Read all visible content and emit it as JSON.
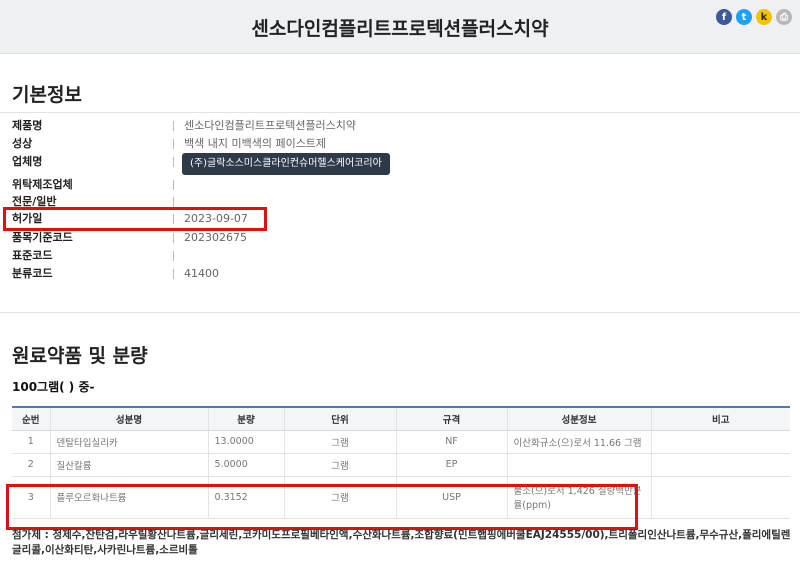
{
  "header": {
    "title": "센소다인컴플리트프로텍션플러스치약",
    "share": [
      {
        "name": "facebook-icon",
        "glyph": "f"
      },
      {
        "name": "twitter-icon",
        "glyph": "t"
      },
      {
        "name": "kakaostory-icon",
        "glyph": "k"
      },
      {
        "name": "print-icon",
        "glyph": "⎙"
      }
    ]
  },
  "basic_info": {
    "title": "기본정보",
    "rows": [
      {
        "label": "제품명",
        "value": "센소다인컴플리트프로텍션플러스치약"
      },
      {
        "label": "성상",
        "value": "백색 내지 미백색의 페이스트제"
      },
      {
        "label": "업체명",
        "value": "(주)글락소스미스클라인컨슈머헬스케어코리아"
      },
      {
        "label": "위탁제조업체",
        "value": ""
      },
      {
        "label": "전문/일반",
        "value": ""
      },
      {
        "label": "허가일",
        "value": "2023-09-07"
      },
      {
        "label": "품목기준코드",
        "value": "202302675"
      },
      {
        "label": "표준코드",
        "value": ""
      },
      {
        "label": "분류코드",
        "value": "41400"
      }
    ]
  },
  "ingredients": {
    "title": "원료약품 및 분량",
    "subtitle": "100그램( ) 중-",
    "columns": [
      "순번",
      "성분명",
      "분량",
      "단위",
      "규격",
      "성분정보",
      "비고"
    ],
    "rows": [
      [
        "1",
        "덴탈타입실리카",
        "13.0000",
        "그램",
        "NF",
        "이산화규소(으)로서 11.66 그램",
        ""
      ],
      [
        "2",
        "질산칼륨",
        "5.0000",
        "그램",
        "EP",
        "",
        ""
      ],
      [
        "3",
        "플루오르화나트륨",
        "0.3152",
        "그램",
        "USP",
        "불소(으)로서 1,426 질량백만분율(ppm)",
        ""
      ]
    ]
  },
  "additives": {
    "text": "첨가제 : 정제수,잔탄검,라우릴황산나트륨,글리세린,코카미도프로필베타인액,수산화나트륨,조합향료(민트햅핑에버쿨EAJ24555/00),트리폴리인산나트륨,무수규산,폴리에틸렌글리콜,이산화티탄,사카린나트륨,소르비톨"
  }
}
